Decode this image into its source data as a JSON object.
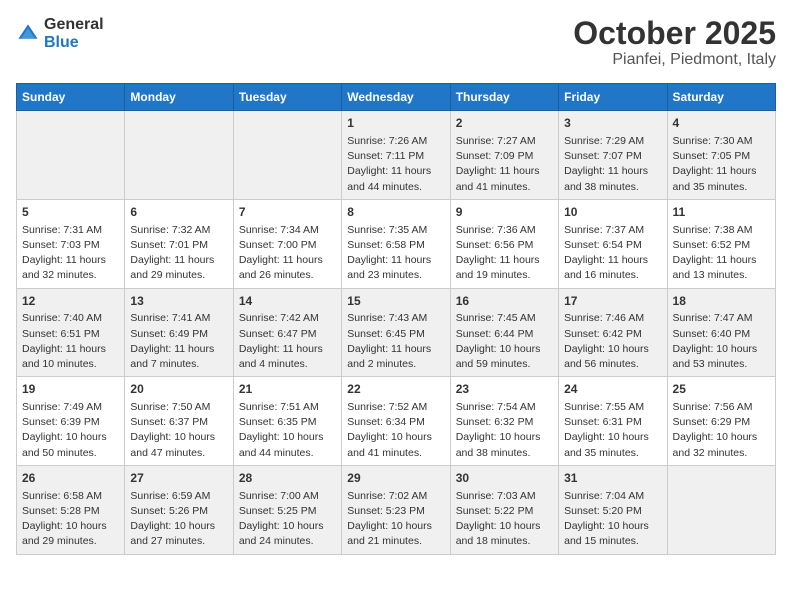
{
  "logo": {
    "text_general": "General",
    "text_blue": "Blue"
  },
  "title": "October 2025",
  "subtitle": "Pianfei, Piedmont, Italy",
  "days_of_week": [
    "Sunday",
    "Monday",
    "Tuesday",
    "Wednesday",
    "Thursday",
    "Friday",
    "Saturday"
  ],
  "weeks": [
    [
      {
        "day": "",
        "sunrise": "",
        "sunset": "",
        "daylight": ""
      },
      {
        "day": "",
        "sunrise": "",
        "sunset": "",
        "daylight": ""
      },
      {
        "day": "",
        "sunrise": "",
        "sunset": "",
        "daylight": ""
      },
      {
        "day": "1",
        "sunrise": "Sunrise: 7:26 AM",
        "sunset": "Sunset: 7:11 PM",
        "daylight": "Daylight: 11 hours and 44 minutes."
      },
      {
        "day": "2",
        "sunrise": "Sunrise: 7:27 AM",
        "sunset": "Sunset: 7:09 PM",
        "daylight": "Daylight: 11 hours and 41 minutes."
      },
      {
        "day": "3",
        "sunrise": "Sunrise: 7:29 AM",
        "sunset": "Sunset: 7:07 PM",
        "daylight": "Daylight: 11 hours and 38 minutes."
      },
      {
        "day": "4",
        "sunrise": "Sunrise: 7:30 AM",
        "sunset": "Sunset: 7:05 PM",
        "daylight": "Daylight: 11 hours and 35 minutes."
      }
    ],
    [
      {
        "day": "5",
        "sunrise": "Sunrise: 7:31 AM",
        "sunset": "Sunset: 7:03 PM",
        "daylight": "Daylight: 11 hours and 32 minutes."
      },
      {
        "day": "6",
        "sunrise": "Sunrise: 7:32 AM",
        "sunset": "Sunset: 7:01 PM",
        "daylight": "Daylight: 11 hours and 29 minutes."
      },
      {
        "day": "7",
        "sunrise": "Sunrise: 7:34 AM",
        "sunset": "Sunset: 7:00 PM",
        "daylight": "Daylight: 11 hours and 26 minutes."
      },
      {
        "day": "8",
        "sunrise": "Sunrise: 7:35 AM",
        "sunset": "Sunset: 6:58 PM",
        "daylight": "Daylight: 11 hours and 23 minutes."
      },
      {
        "day": "9",
        "sunrise": "Sunrise: 7:36 AM",
        "sunset": "Sunset: 6:56 PM",
        "daylight": "Daylight: 11 hours and 19 minutes."
      },
      {
        "day": "10",
        "sunrise": "Sunrise: 7:37 AM",
        "sunset": "Sunset: 6:54 PM",
        "daylight": "Daylight: 11 hours and 16 minutes."
      },
      {
        "day": "11",
        "sunrise": "Sunrise: 7:38 AM",
        "sunset": "Sunset: 6:52 PM",
        "daylight": "Daylight: 11 hours and 13 minutes."
      }
    ],
    [
      {
        "day": "12",
        "sunrise": "Sunrise: 7:40 AM",
        "sunset": "Sunset: 6:51 PM",
        "daylight": "Daylight: 11 hours and 10 minutes."
      },
      {
        "day": "13",
        "sunrise": "Sunrise: 7:41 AM",
        "sunset": "Sunset: 6:49 PM",
        "daylight": "Daylight: 11 hours and 7 minutes."
      },
      {
        "day": "14",
        "sunrise": "Sunrise: 7:42 AM",
        "sunset": "Sunset: 6:47 PM",
        "daylight": "Daylight: 11 hours and 4 minutes."
      },
      {
        "day": "15",
        "sunrise": "Sunrise: 7:43 AM",
        "sunset": "Sunset: 6:45 PM",
        "daylight": "Daylight: 11 hours and 2 minutes."
      },
      {
        "day": "16",
        "sunrise": "Sunrise: 7:45 AM",
        "sunset": "Sunset: 6:44 PM",
        "daylight": "Daylight: 10 hours and 59 minutes."
      },
      {
        "day": "17",
        "sunrise": "Sunrise: 7:46 AM",
        "sunset": "Sunset: 6:42 PM",
        "daylight": "Daylight: 10 hours and 56 minutes."
      },
      {
        "day": "18",
        "sunrise": "Sunrise: 7:47 AM",
        "sunset": "Sunset: 6:40 PM",
        "daylight": "Daylight: 10 hours and 53 minutes."
      }
    ],
    [
      {
        "day": "19",
        "sunrise": "Sunrise: 7:49 AM",
        "sunset": "Sunset: 6:39 PM",
        "daylight": "Daylight: 10 hours and 50 minutes."
      },
      {
        "day": "20",
        "sunrise": "Sunrise: 7:50 AM",
        "sunset": "Sunset: 6:37 PM",
        "daylight": "Daylight: 10 hours and 47 minutes."
      },
      {
        "day": "21",
        "sunrise": "Sunrise: 7:51 AM",
        "sunset": "Sunset: 6:35 PM",
        "daylight": "Daylight: 10 hours and 44 minutes."
      },
      {
        "day": "22",
        "sunrise": "Sunrise: 7:52 AM",
        "sunset": "Sunset: 6:34 PM",
        "daylight": "Daylight: 10 hours and 41 minutes."
      },
      {
        "day": "23",
        "sunrise": "Sunrise: 7:54 AM",
        "sunset": "Sunset: 6:32 PM",
        "daylight": "Daylight: 10 hours and 38 minutes."
      },
      {
        "day": "24",
        "sunrise": "Sunrise: 7:55 AM",
        "sunset": "Sunset: 6:31 PM",
        "daylight": "Daylight: 10 hours and 35 minutes."
      },
      {
        "day": "25",
        "sunrise": "Sunrise: 7:56 AM",
        "sunset": "Sunset: 6:29 PM",
        "daylight": "Daylight: 10 hours and 32 minutes."
      }
    ],
    [
      {
        "day": "26",
        "sunrise": "Sunrise: 6:58 AM",
        "sunset": "Sunset: 5:28 PM",
        "daylight": "Daylight: 10 hours and 29 minutes."
      },
      {
        "day": "27",
        "sunrise": "Sunrise: 6:59 AM",
        "sunset": "Sunset: 5:26 PM",
        "daylight": "Daylight: 10 hours and 27 minutes."
      },
      {
        "day": "28",
        "sunrise": "Sunrise: 7:00 AM",
        "sunset": "Sunset: 5:25 PM",
        "daylight": "Daylight: 10 hours and 24 minutes."
      },
      {
        "day": "29",
        "sunrise": "Sunrise: 7:02 AM",
        "sunset": "Sunset: 5:23 PM",
        "daylight": "Daylight: 10 hours and 21 minutes."
      },
      {
        "day": "30",
        "sunrise": "Sunrise: 7:03 AM",
        "sunset": "Sunset: 5:22 PM",
        "daylight": "Daylight: 10 hours and 18 minutes."
      },
      {
        "day": "31",
        "sunrise": "Sunrise: 7:04 AM",
        "sunset": "Sunset: 5:20 PM",
        "daylight": "Daylight: 10 hours and 15 minutes."
      },
      {
        "day": "",
        "sunrise": "",
        "sunset": "",
        "daylight": ""
      }
    ]
  ]
}
